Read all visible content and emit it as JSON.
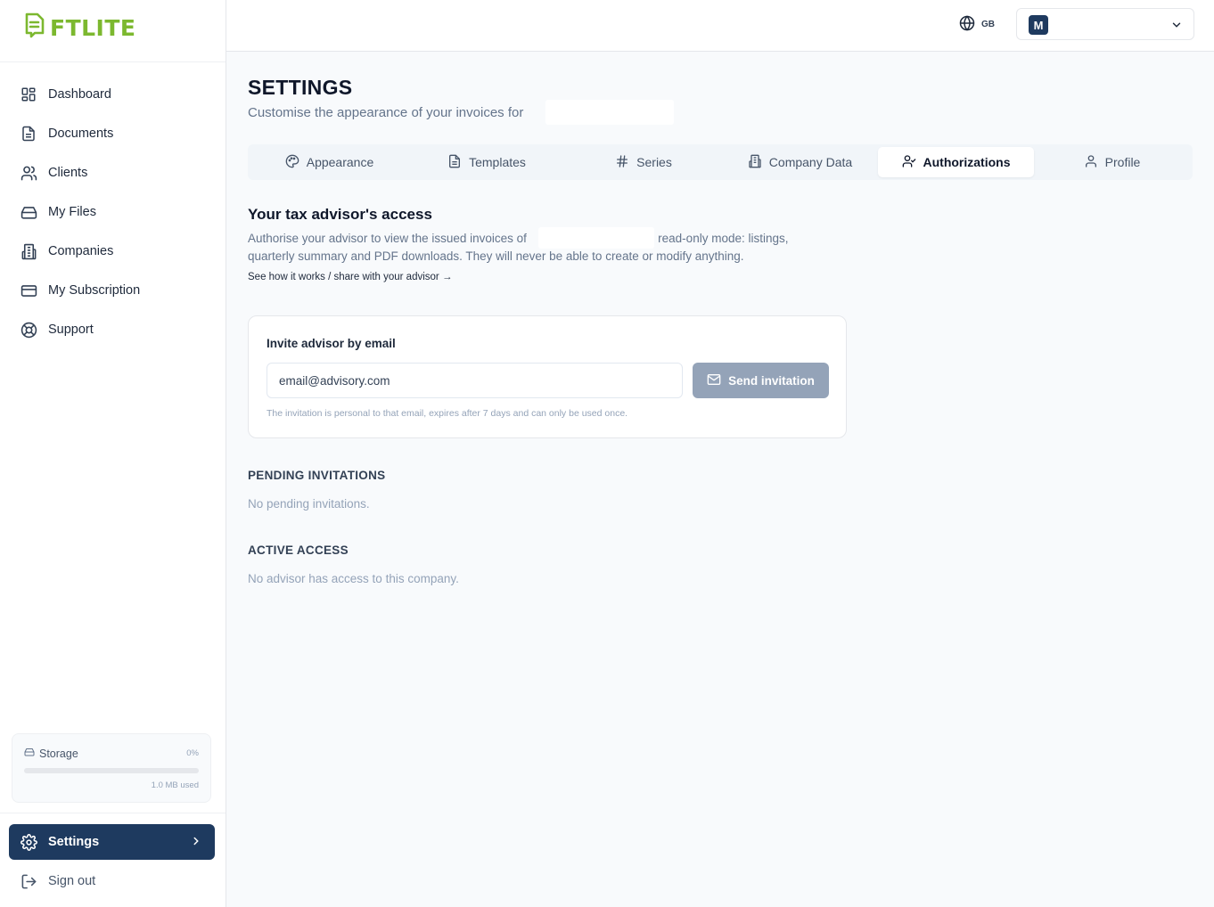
{
  "brand": {
    "name": "FTLITE",
    "color": "#7cb82f",
    "icon": "invoice-logo-icon"
  },
  "sidebar": {
    "items": [
      {
        "label": "Dashboard",
        "icon": "dashboard-grid-icon"
      },
      {
        "label": "Documents",
        "icon": "document-icon"
      },
      {
        "label": "Clients",
        "icon": "users-icon"
      },
      {
        "label": "My Files",
        "icon": "drive-icon"
      },
      {
        "label": "Companies",
        "icon": "building-icon"
      },
      {
        "label": "My Subscription",
        "icon": "credit-card-icon"
      },
      {
        "label": "Support",
        "icon": "lifebuoy-icon"
      }
    ],
    "storage": {
      "label": "Storage",
      "percent_label": "0%",
      "fraction": 0,
      "used_label": "1.0 MB used"
    },
    "settings_label": "Settings",
    "signout_label": "Sign out"
  },
  "header": {
    "language": "GB",
    "account_initial": "M"
  },
  "page": {
    "title": "SETTINGS",
    "subtitle": "Customise the appearance of your invoices for"
  },
  "tabs": [
    {
      "label": "Appearance",
      "icon": "palette-icon",
      "active": false
    },
    {
      "label": "Templates",
      "icon": "file-text-icon",
      "active": false
    },
    {
      "label": "Series",
      "icon": "hash-icon",
      "active": false
    },
    {
      "label": "Company Data",
      "icon": "building-icon",
      "active": false
    },
    {
      "label": "Authorizations",
      "icon": "user-check-icon",
      "active": true
    },
    {
      "label": "Profile",
      "icon": "user-icon",
      "active": false
    }
  ],
  "advisor": {
    "title": "Your tax advisor's access",
    "desc_line1_a": "Authorise your advisor to view the issued invoices of",
    "desc_line1_b": "in read-only mode: listings,",
    "desc_line2": "quarterly summary and PDF downloads. They will never be able to create or modify anything.",
    "link": "See how it works / share with your advisor →"
  },
  "invite": {
    "label": "Invite advisor by email",
    "placeholder": "email@advisory.com",
    "button": "Send invitation",
    "help": "The invitation is personal to that email, expires after 7 days and can only be used once."
  },
  "pending": {
    "title": "PENDING INVITATIONS",
    "empty": "No pending invitations."
  },
  "active_access": {
    "title": "ACTIVE ACCESS",
    "empty": "No advisor has access to this company."
  },
  "colors": {
    "primary": "#1e3a5f",
    "accent": "#7cb82f",
    "button_disabled": "#94a3b8"
  }
}
